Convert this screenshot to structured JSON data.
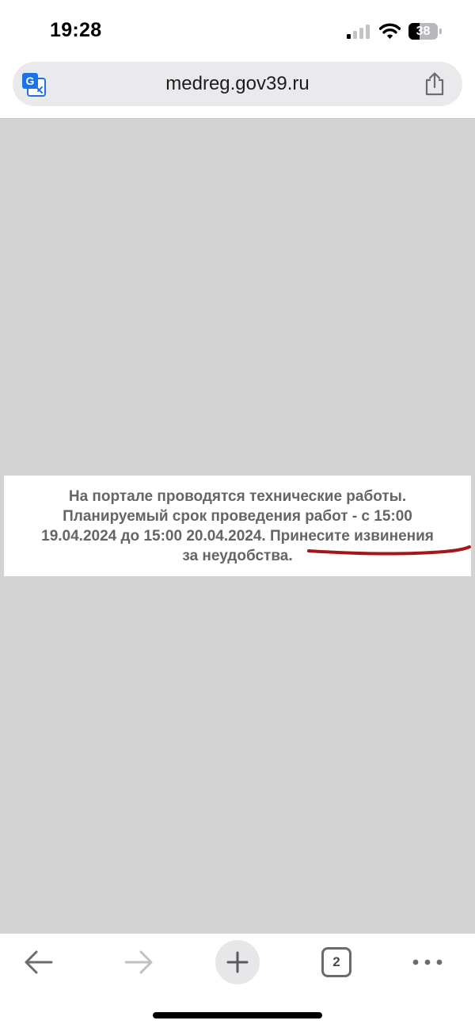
{
  "status_bar": {
    "time": "19:28",
    "battery_text": "38",
    "battery_level": 0.38,
    "signal_bars_active": 1,
    "signal_bars_total": 4
  },
  "address_bar": {
    "url": "medreg.gov39.ru",
    "left_icon": "translate-icon",
    "right_icon": "share-icon"
  },
  "notice": {
    "line1": "На портале проводятся технические работы.",
    "line2": "Планируемый срок проведения работ - с 15:00",
    "line3_part1": "19.04.2024 до 15:00 20.04.2024. ",
    "line3_part2": "Принесите извинения",
    "line4": "за неудобства."
  },
  "annotation": {
    "type": "hand-drawn underline",
    "color": "#a4161b"
  },
  "toolbar": {
    "back_icon": "arrow-left-icon",
    "forward_icon": "arrow-right-icon",
    "new_tab_icon": "plus-icon",
    "tabs_count": "2",
    "menu_icon": "more-dots-icon"
  },
  "colors": {
    "page_background": "#d3d3d3",
    "notice_text": "#656565",
    "address_bar": "#eaeaed",
    "translate_icon": "#1a73e8"
  }
}
